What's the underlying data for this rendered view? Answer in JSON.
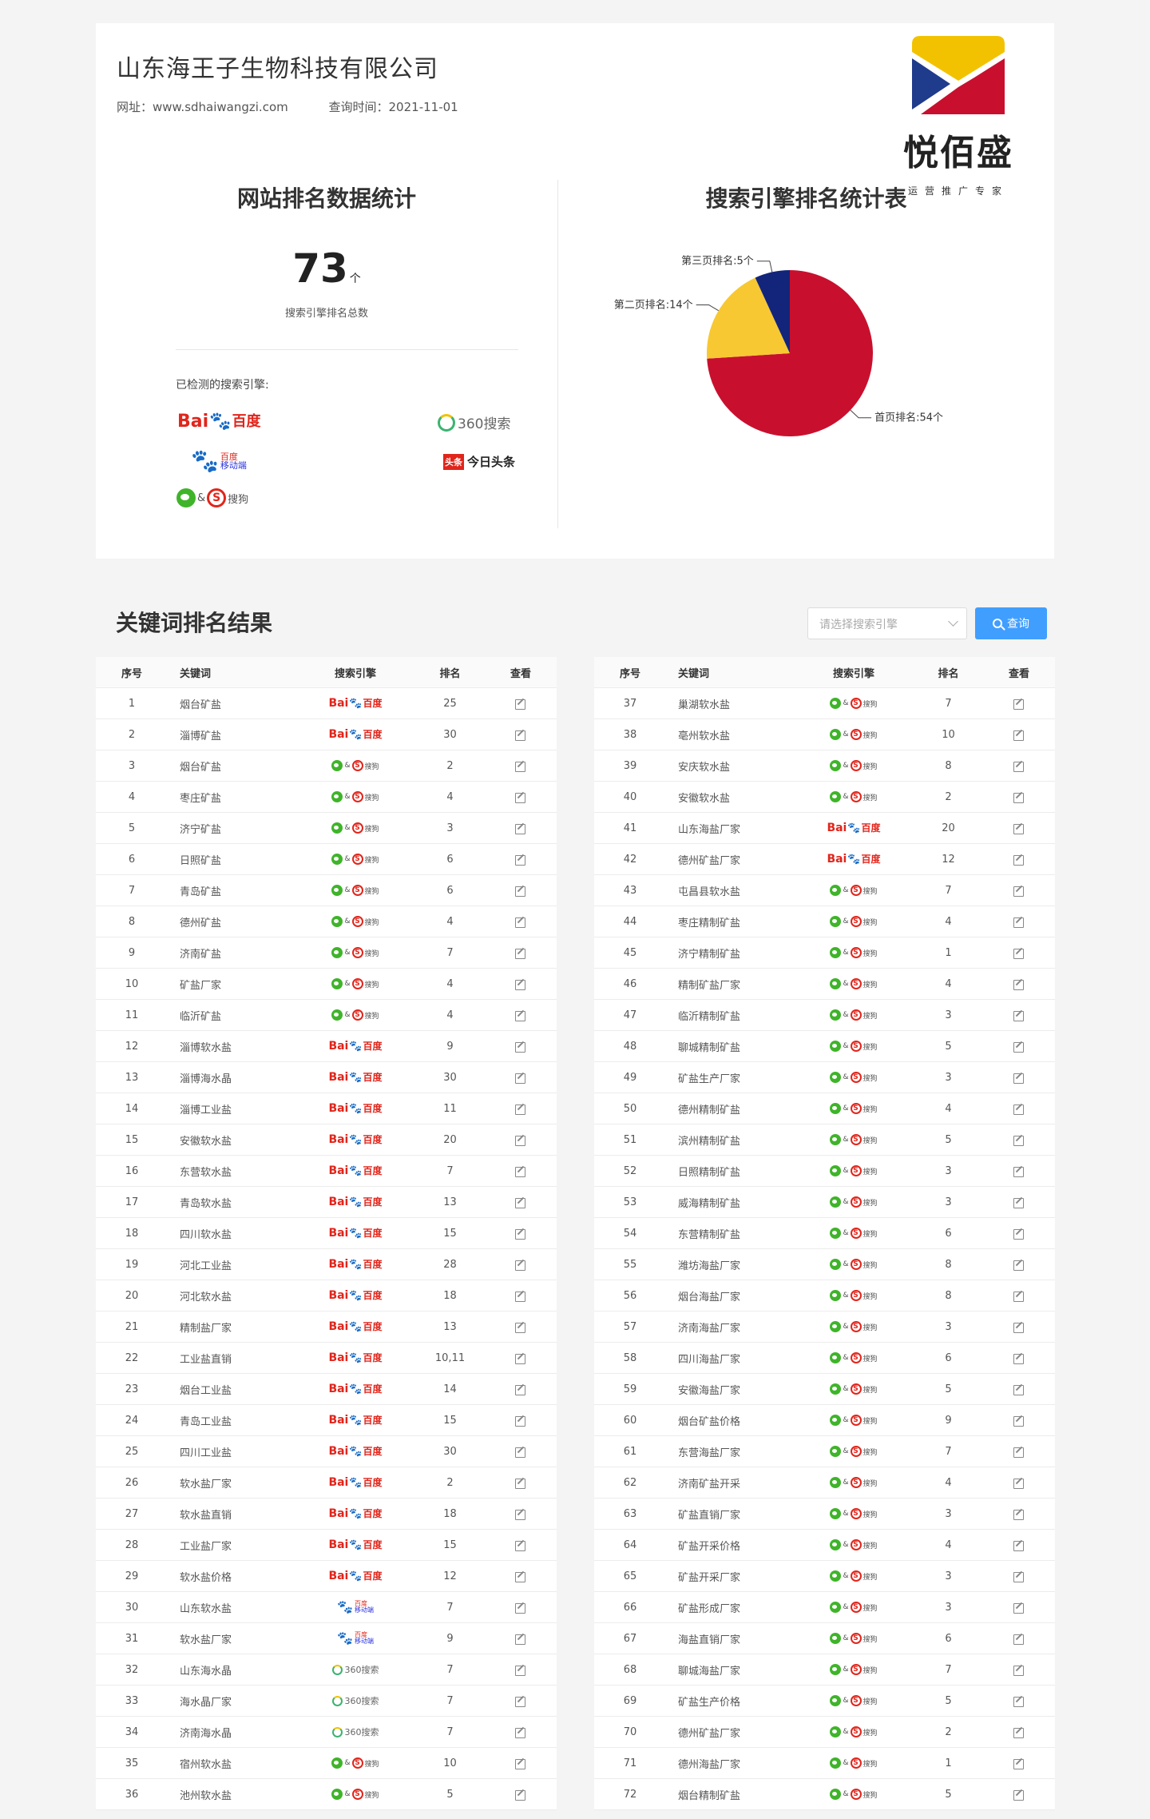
{
  "header": {
    "company": "山东海王子生物科技有限公司",
    "website": "网址：www.sdhaiwangzi.com",
    "query_time": "查询时间：2021-11-01"
  },
  "brand": {
    "name": "悦佰盛",
    "tagline": "运营推广专家",
    "colors": [
      "#f2c200",
      "#1f3b8c",
      "#c8102e"
    ]
  },
  "stats": {
    "title": "网站排名数据统计",
    "total": "73",
    "unit": "个",
    "total_label": "搜索引擎排名总数",
    "engines_label": "已检测的搜索引擎:"
  },
  "engines": {
    "baidu": {
      "bai": "Bai",
      "paw": "🐾",
      "du": "百度"
    },
    "e360": {
      "text": "360搜索"
    },
    "mobile": {
      "paw": "🐾",
      "line1": "百度",
      "line2": "移动端"
    },
    "toutiao": {
      "badge": "头条",
      "text": "今日头条"
    },
    "wx": {
      "amp": "&",
      "sg": "S",
      "text": "搜狗"
    }
  },
  "chart_data": {
    "type": "pie",
    "title": "搜索引擎排名统计表",
    "slices": [
      {
        "label": "首页排名:54个",
        "value": 54,
        "color": "#c8102e"
      },
      {
        "label": "第二页排名:14个",
        "value": 14,
        "color": "#f7c832"
      },
      {
        "label": "第三页排名:5个",
        "value": 5,
        "color": "#13257a"
      }
    ]
  },
  "keywords": {
    "title": "关键词排名结果",
    "select_placeholder": "请选择搜索引擎",
    "search_button": "查询",
    "columns": [
      "序号",
      "关键词",
      "搜索引擎",
      "排名",
      "查看"
    ],
    "left": [
      [
        "1",
        "烟台矿盐",
        "baidu",
        "25"
      ],
      [
        "2",
        "淄博矿盐",
        "baidu",
        "30"
      ],
      [
        "3",
        "烟台矿盐",
        "wx",
        "2"
      ],
      [
        "4",
        "枣庄矿盐",
        "wx",
        "4"
      ],
      [
        "5",
        "济宁矿盐",
        "wx",
        "3"
      ],
      [
        "6",
        "日照矿盐",
        "wx",
        "6"
      ],
      [
        "7",
        "青岛矿盐",
        "wx",
        "6"
      ],
      [
        "8",
        "德州矿盐",
        "wx",
        "4"
      ],
      [
        "9",
        "济南矿盐",
        "wx",
        "7"
      ],
      [
        "10",
        "矿盐厂家",
        "wx",
        "4"
      ],
      [
        "11",
        "临沂矿盐",
        "wx",
        "4"
      ],
      [
        "12",
        "淄博软水盐",
        "baidu",
        "9"
      ],
      [
        "13",
        "淄博海水晶",
        "baidu",
        "30"
      ],
      [
        "14",
        "淄博工业盐",
        "baidu",
        "11"
      ],
      [
        "15",
        "安徽软水盐",
        "baidu",
        "20"
      ],
      [
        "16",
        "东营软水盐",
        "baidu",
        "7"
      ],
      [
        "17",
        "青岛软水盐",
        "baidu",
        "13"
      ],
      [
        "18",
        "四川软水盐",
        "baidu",
        "15"
      ],
      [
        "19",
        "河北工业盐",
        "baidu",
        "28"
      ],
      [
        "20",
        "河北软水盐",
        "baidu",
        "18"
      ],
      [
        "21",
        "精制盐厂家",
        "baidu",
        "13"
      ],
      [
        "22",
        "工业盐直销",
        "baidu",
        "10,11"
      ],
      [
        "23",
        "烟台工业盐",
        "baidu",
        "14"
      ],
      [
        "24",
        "青岛工业盐",
        "baidu",
        "15"
      ],
      [
        "25",
        "四川工业盐",
        "baidu",
        "30"
      ],
      [
        "26",
        "软水盐厂家",
        "baidu",
        "2"
      ],
      [
        "27",
        "软水盐直销",
        "baidu",
        "18"
      ],
      [
        "28",
        "工业盐厂家",
        "baidu",
        "15"
      ],
      [
        "29",
        "软水盐价格",
        "baidu",
        "12"
      ],
      [
        "30",
        "山东软水盐",
        "mobile",
        "7"
      ],
      [
        "31",
        "软水盐厂家",
        "mobile",
        "9"
      ],
      [
        "32",
        "山东海水晶",
        "e360",
        "7"
      ],
      [
        "33",
        "海水晶厂家",
        "e360",
        "7"
      ],
      [
        "34",
        "济南海水晶",
        "e360",
        "7"
      ],
      [
        "35",
        "宿州软水盐",
        "wx",
        "10"
      ],
      [
        "36",
        "池州软水盐",
        "wx",
        "5"
      ]
    ],
    "right": [
      [
        "37",
        "巢湖软水盐",
        "wx",
        "7"
      ],
      [
        "38",
        "亳州软水盐",
        "wx",
        "10"
      ],
      [
        "39",
        "安庆软水盐",
        "wx",
        "8"
      ],
      [
        "40",
        "安徽软水盐",
        "wx",
        "2"
      ],
      [
        "41",
        "山东海盐厂家",
        "baidu",
        "20"
      ],
      [
        "42",
        "德州矿盐厂家",
        "baidu",
        "12"
      ],
      [
        "43",
        "屯昌县软水盐",
        "wx",
        "7"
      ],
      [
        "44",
        "枣庄精制矿盐",
        "wx",
        "4"
      ],
      [
        "45",
        "济宁精制矿盐",
        "wx",
        "1"
      ],
      [
        "46",
        "精制矿盐厂家",
        "wx",
        "4"
      ],
      [
        "47",
        "临沂精制矿盐",
        "wx",
        "3"
      ],
      [
        "48",
        "聊城精制矿盐",
        "wx",
        "5"
      ],
      [
        "49",
        "矿盐生产厂家",
        "wx",
        "3"
      ],
      [
        "50",
        "德州精制矿盐",
        "wx",
        "4"
      ],
      [
        "51",
        "滨州精制矿盐",
        "wx",
        "5"
      ],
      [
        "52",
        "日照精制矿盐",
        "wx",
        "3"
      ],
      [
        "53",
        "威海精制矿盐",
        "wx",
        "3"
      ],
      [
        "54",
        "东营精制矿盐",
        "wx",
        "6"
      ],
      [
        "55",
        "潍坊海盐厂家",
        "wx",
        "8"
      ],
      [
        "56",
        "烟台海盐厂家",
        "wx",
        "8"
      ],
      [
        "57",
        "济南海盐厂家",
        "wx",
        "3"
      ],
      [
        "58",
        "四川海盐厂家",
        "wx",
        "6"
      ],
      [
        "59",
        "安徽海盐厂家",
        "wx",
        "5"
      ],
      [
        "60",
        "烟台矿盐价格",
        "wx",
        "9"
      ],
      [
        "61",
        "东营海盐厂家",
        "wx",
        "7"
      ],
      [
        "62",
        "济南矿盐开采",
        "wx",
        "4"
      ],
      [
        "63",
        "矿盐直销厂家",
        "wx",
        "3"
      ],
      [
        "64",
        "矿盐开采价格",
        "wx",
        "4"
      ],
      [
        "65",
        "矿盐开采厂家",
        "wx",
        "3"
      ],
      [
        "66",
        "矿盐形成厂家",
        "wx",
        "3"
      ],
      [
        "67",
        "海盐直销厂家",
        "wx",
        "6"
      ],
      [
        "68",
        "聊城海盐厂家",
        "wx",
        "7"
      ],
      [
        "69",
        "矿盐生产价格",
        "wx",
        "5"
      ],
      [
        "70",
        "德州矿盐厂家",
        "wx",
        "2"
      ],
      [
        "71",
        "德州海盐厂家",
        "wx",
        "1"
      ],
      [
        "72",
        "烟台精制矿盐",
        "wx",
        "5"
      ]
    ]
  }
}
